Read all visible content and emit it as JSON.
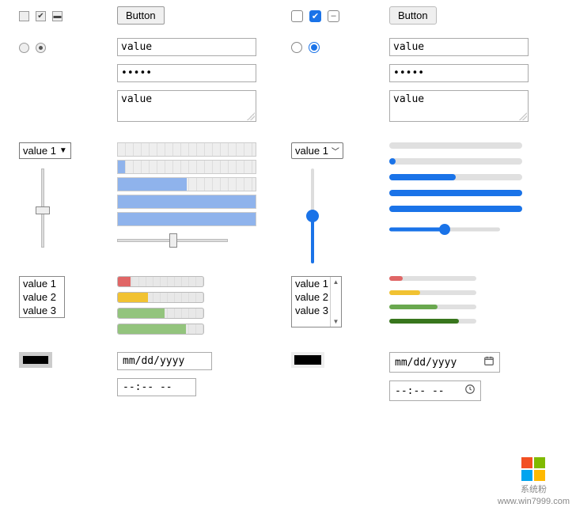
{
  "buttons": {
    "label": "Button"
  },
  "text_input": {
    "value": "value"
  },
  "password_input": {
    "masked": "•••••"
  },
  "textarea": {
    "value": "value"
  },
  "select": {
    "selected": "value 1",
    "caret_old": "▼",
    "caret_new": "˅"
  },
  "listbox": {
    "options": [
      "value 1",
      "value 2",
      "value 3"
    ]
  },
  "date_input": {
    "placeholder": "mm/dd/yyyy"
  },
  "time_input": {
    "placeholder": "--:-- --"
  },
  "color_input": {
    "value": "#000000"
  },
  "checkboxes_old": {
    "states": [
      "unchecked",
      "checked",
      "indeterminate"
    ]
  },
  "checkboxes_new": {
    "states": [
      "unchecked",
      "checked",
      "indeterminate"
    ]
  },
  "radios_old": {
    "states": [
      "unselected",
      "selected"
    ]
  },
  "radios_new": {
    "states": [
      "unselected",
      "selected"
    ]
  },
  "progress_old_pct": [
    0,
    5,
    50,
    100,
    100
  ],
  "progress_new_pct": [
    0,
    5,
    50,
    100,
    100
  ],
  "slider_old": {
    "vertical_pct": 50,
    "horizontal_pct": 50
  },
  "slider_new": {
    "vertical_pct": 50,
    "horizontal_pct": 50
  },
  "meters_old": [
    {
      "pct": 15,
      "color": "#e06666"
    },
    {
      "pct": 35,
      "color": "#f1c232"
    },
    {
      "pct": 55,
      "color": "#93c47d"
    },
    {
      "pct": 80,
      "color": "#6aa84f"
    }
  ],
  "meters_new": [
    {
      "pct": 15,
      "color": "#e06666"
    },
    {
      "pct": 35,
      "color": "#f1c232"
    },
    {
      "pct": 55,
      "color": "#6aa84f"
    },
    {
      "pct": 80,
      "color": "#38761d"
    }
  ],
  "watermark": {
    "text": "系统粉",
    "url": "www.win7999.com"
  }
}
